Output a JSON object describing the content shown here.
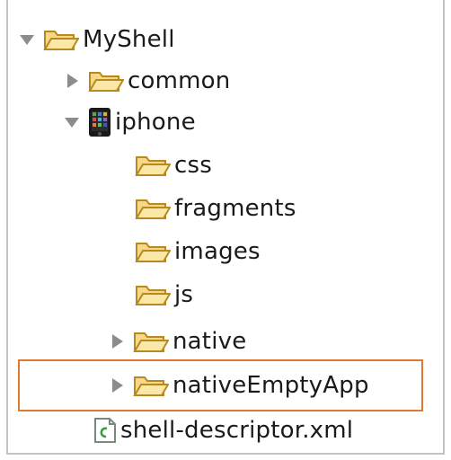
{
  "tree": {
    "items": [
      {
        "label": "MyShell",
        "icon": "folder-open-icon",
        "twisty": "expanded"
      },
      {
        "label": "common",
        "icon": "folder-open-icon",
        "twisty": "collapsed"
      },
      {
        "label": "iphone",
        "icon": "iphone-icon",
        "twisty": "expanded"
      },
      {
        "label": "css",
        "icon": "folder-open-icon",
        "twisty": "none"
      },
      {
        "label": "fragments",
        "icon": "folder-open-icon",
        "twisty": "none"
      },
      {
        "label": "images",
        "icon": "folder-open-icon",
        "twisty": "none"
      },
      {
        "label": "js",
        "icon": "folder-open-icon",
        "twisty": "none"
      },
      {
        "label": "native",
        "icon": "folder-open-icon",
        "twisty": "collapsed"
      },
      {
        "label": "nativeEmptyApp",
        "icon": "folder-open-icon",
        "twisty": "collapsed",
        "selected": true
      },
      {
        "label": "shell-descriptor.xml",
        "icon": "file-icon",
        "twisty": "none"
      }
    ]
  },
  "colors": {
    "highlight": "#e07a2e",
    "folder_fill": "#f6d88a",
    "folder_stroke": "#b88a1e",
    "twisty": "#8c8c8c",
    "text": "#1a1a1a"
  }
}
